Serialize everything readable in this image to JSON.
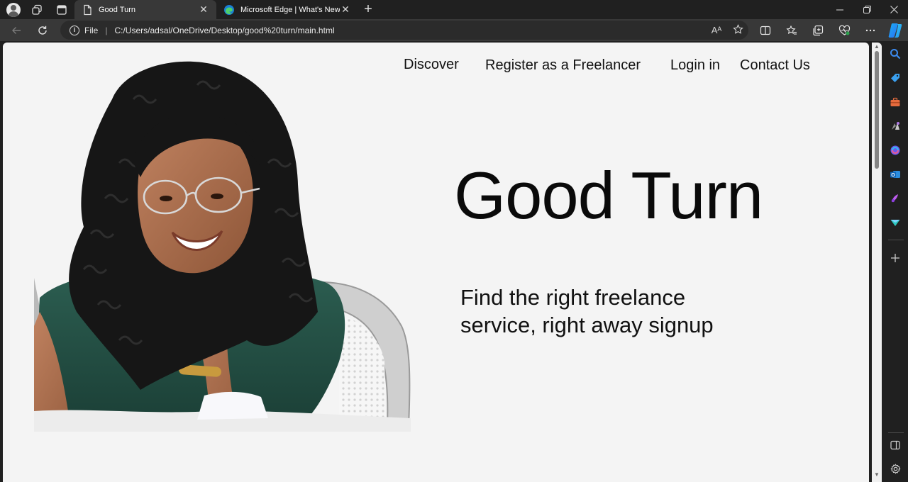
{
  "browser": {
    "tabs": [
      {
        "title": "Good Turn",
        "active": true,
        "icon": "page-icon"
      },
      {
        "title": "Microsoft Edge | What's New",
        "active": false,
        "icon": "edge-logo-icon"
      }
    ],
    "address": {
      "scheme_label": "File",
      "separator": "|",
      "url": "C:/Users/adsal/OneDrive/Desktop/good%20turn/main.html"
    },
    "read_aloud_glyph": "Aᴬ",
    "new_tab_glyph": "+",
    "close_glyph": "✕"
  },
  "page": {
    "nav": {
      "discover": "Discover",
      "register": "Register as a Freelancer",
      "login": "Login in",
      "contact": "Contact Us"
    },
    "title": "Good Turn",
    "subtitle": "Find the right freelance service, right away signup",
    "photo_alt": "Smiling woman with curly hair and glasses resting her chin on her hand"
  },
  "colors": {
    "page_bg": "#f4f4f4",
    "chrome_dark": "#202020",
    "toolbar": "#383838",
    "shirt": "#234f44",
    "skin": "#a66a4a",
    "hair": "#151515"
  }
}
